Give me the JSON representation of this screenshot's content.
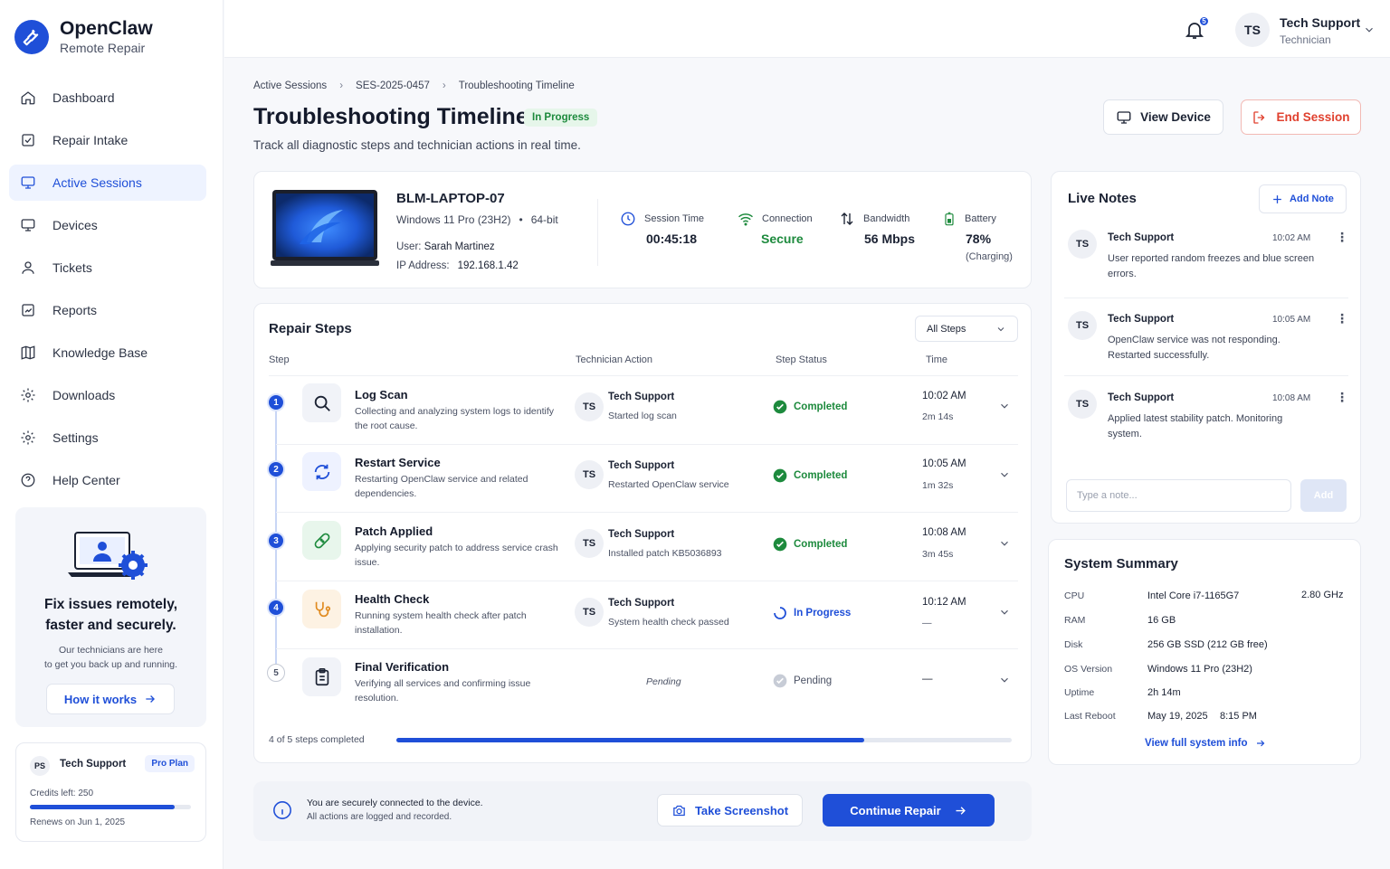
{
  "brand": {
    "name": "OpenClaw",
    "subtitle": "Remote Repair"
  },
  "nav": [
    {
      "label": "Dashboard",
      "icon": "home-icon"
    },
    {
      "label": "Repair Intake",
      "icon": "clipboard-check-icon"
    },
    {
      "label": "Active Sessions",
      "icon": "monitor-icon",
      "active": true
    },
    {
      "label": "Devices",
      "icon": "monitor-icon"
    },
    {
      "label": "Tickets",
      "icon": "user-icon"
    },
    {
      "label": "Reports",
      "icon": "chart-icon"
    },
    {
      "label": "Knowledge Base",
      "icon": "book-icon"
    },
    {
      "label": "Downloads",
      "icon": "gear-icon"
    },
    {
      "label": "Settings",
      "icon": "gear-icon"
    },
    {
      "label": "Help Center",
      "icon": "help-icon"
    }
  ],
  "promo": {
    "title_line1": "Fix issues remotely,",
    "title_line2": "faster and securely.",
    "text_line1": "Our technicians are here",
    "text_line2": "to get you back up and running.",
    "button": "How it works"
  },
  "plan": {
    "initials": "PS",
    "name": "Tech Support",
    "badge": "Pro Plan",
    "credits": "Credits left: 250",
    "credits_fraction": 0.9,
    "renews": "Renews on Jun 1, 2025"
  },
  "header": {
    "notifications": "5",
    "user_initials": "TS",
    "user_name": "Tech Support",
    "user_role": "Technician"
  },
  "breadcrumb": [
    "Active Sessions",
    "SES-2025-0457",
    "Troubleshooting Timeline"
  ],
  "page": {
    "title": "Troubleshooting Timeline",
    "badge": "In Progress",
    "subtitle": "Track all diagnostic steps and technician actions in real time.",
    "view_device": "View Device",
    "end_session": "End Session"
  },
  "device": {
    "name": "BLM-LAPTOP-07",
    "os": "Windows 11 Pro (23H2)",
    "arch": "64-bit",
    "user_label": "User:",
    "user": "Sarah Martinez",
    "ip_label": "IP Address:",
    "ip": "192.168.1.42",
    "stats": {
      "session_label": "Session Time",
      "session_value": "00:45:18",
      "connection_label": "Connection",
      "connection_value": "Secure",
      "bandwidth_label": "Bandwidth",
      "bandwidth_value": "56 Mbps",
      "battery_label": "Battery",
      "battery_value": "78%",
      "battery_note": "(Charging)"
    }
  },
  "steps": {
    "title": "Repair Steps",
    "filter": "All Steps",
    "columns": {
      "step": "Step",
      "action": "Technician Action",
      "status": "Step Status",
      "time": "Time"
    },
    "rows": [
      {
        "num": "1",
        "name": "Log Scan",
        "desc": "Collecting and analyzing system logs to identify the root cause.",
        "tech": "Tech Support",
        "action": "Started log scan",
        "status": "Completed",
        "time": "10:02 AM",
        "duration": "2m 14s"
      },
      {
        "num": "2",
        "name": "Restart Service",
        "desc": "Restarting OpenClaw service and related dependencies.",
        "tech": "Tech Support",
        "action": "Restarted OpenClaw service",
        "status": "Completed",
        "time": "10:05 AM",
        "duration": "1m 32s"
      },
      {
        "num": "3",
        "name": "Patch Applied",
        "desc": "Applying security patch to address service crash issue.",
        "tech": "Tech Support",
        "action": "Installed patch KB5036893",
        "status": "Completed",
        "time": "10:08 AM",
        "duration": "3m 45s"
      },
      {
        "num": "4",
        "name": "Health Check",
        "desc": "Running system health check after patch installation.",
        "tech": "Tech Support",
        "action": "System health check passed",
        "status": "In Progress",
        "time": "10:12 AM",
        "duration": "—"
      },
      {
        "num": "5",
        "name": "Final Verification",
        "desc": "Verifying all services and confirming issue resolution.",
        "pending_text": "Pending",
        "status": "Pending",
        "time": "—"
      }
    ],
    "tech_initials": "TS",
    "progress_label": "4 of 5 steps completed",
    "progress_fraction": 0.76
  },
  "footer": {
    "secure_line1": "You are securely connected to the device.",
    "secure_line2": "All actions are logged and recorded.",
    "screenshot": "Take Screenshot",
    "continue": "Continue Repair"
  },
  "notes": {
    "title": "Live Notes",
    "add_button": "Add Note",
    "items": [
      {
        "initials": "TS",
        "author": "Tech Support",
        "time": "10:02 AM",
        "text": "User reported random freezes and blue screen errors."
      },
      {
        "initials": "TS",
        "author": "Tech Support",
        "time": "10:05 AM",
        "text": "OpenClaw service was not responding. Restarted successfully."
      },
      {
        "initials": "TS",
        "author": "Tech Support",
        "time": "10:08 AM",
        "text": "Applied latest stability patch. Monitoring system."
      }
    ],
    "input_placeholder": "Type a note...",
    "add_small": "Add"
  },
  "summary": {
    "title": "System Summary",
    "rows": [
      {
        "key": "CPU",
        "value": "Intel Core i7-1165G7",
        "extra": "2.80 GHz"
      },
      {
        "key": "RAM",
        "value": "16 GB"
      },
      {
        "key": "Disk",
        "value": "256 GB SSD (212 GB free)"
      },
      {
        "key": "OS Version",
        "value": "Windows 11 Pro (23H2)"
      },
      {
        "key": "Uptime",
        "value": "2h 14m"
      },
      {
        "key": "Last Reboot",
        "value": "May 19, 2025",
        "extra": "8:15 PM"
      }
    ],
    "link": "View full system info"
  },
  "colors": {
    "accent": "#1f4fd8",
    "success": "#1d8a3d",
    "danger": "#e0412f"
  }
}
